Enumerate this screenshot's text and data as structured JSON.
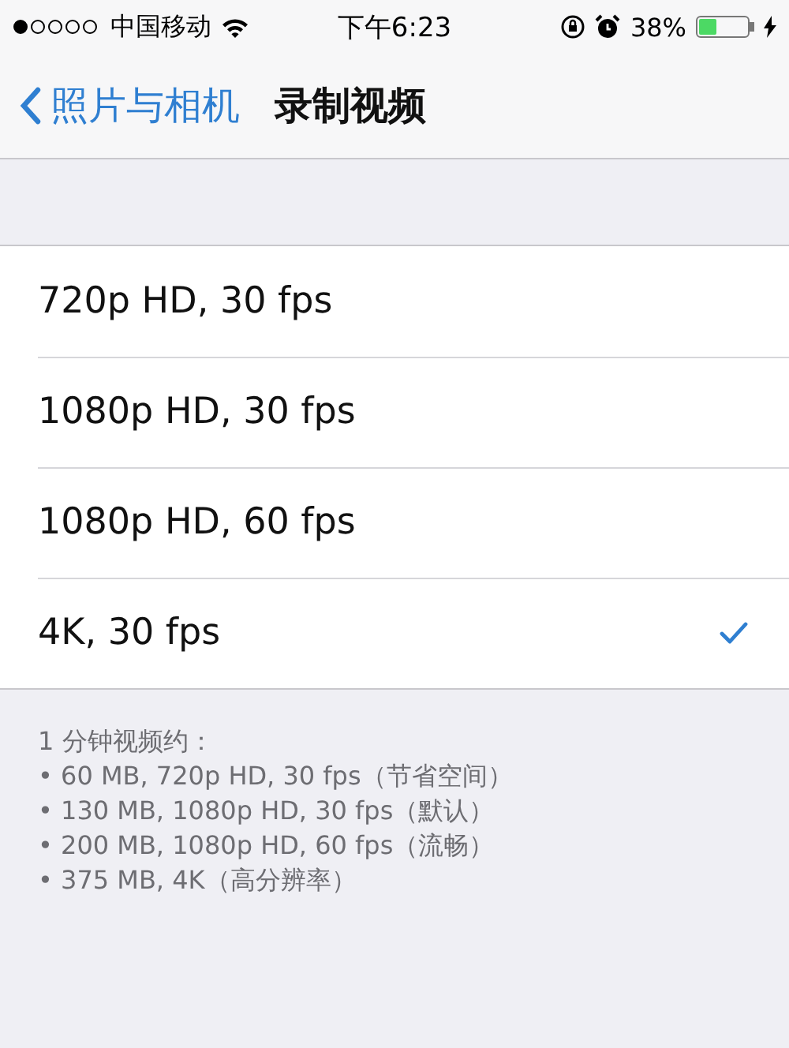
{
  "status_bar": {
    "carrier": "中国移动",
    "time": "下午6:23",
    "battery": "38%"
  },
  "nav": {
    "back": "照片与相机",
    "title": "录制视频"
  },
  "options": [
    {
      "label": "720p HD, 30 fps",
      "selected": false
    },
    {
      "label": "1080p HD, 30 fps",
      "selected": false
    },
    {
      "label": "1080p HD, 60 fps",
      "selected": false
    },
    {
      "label": "4K, 30 fps",
      "selected": true
    }
  ],
  "footer": {
    "heading": "1 分钟视频约：",
    "lines": [
      "• 60 MB, 720p HD, 30 fps（节省空间）",
      "• 130 MB, 1080p HD, 30 fps（默认）",
      "• 200 MB, 1080p HD, 60 fps（流畅）",
      "• 375 MB, 4K（高分辨率）"
    ]
  }
}
